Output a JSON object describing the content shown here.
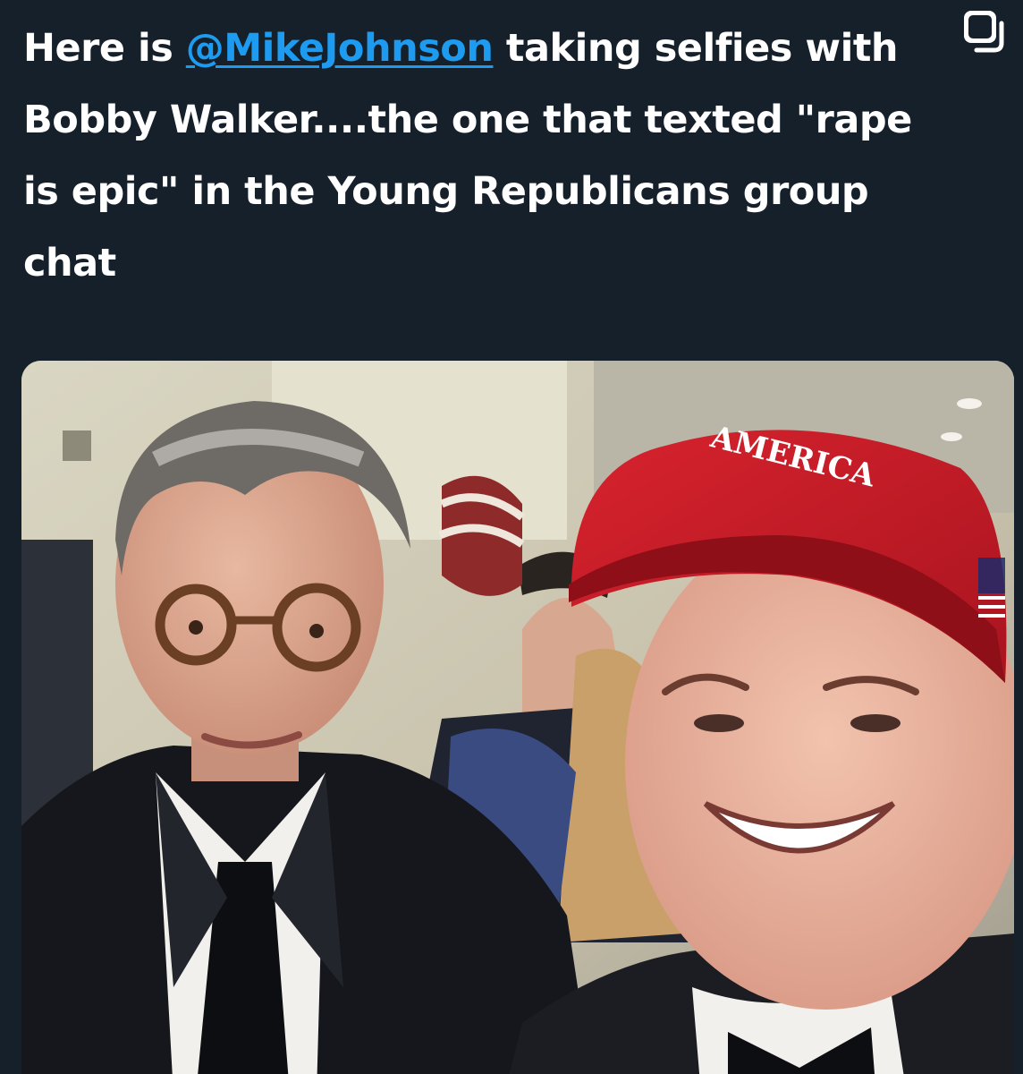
{
  "tweet": {
    "text_before": "Here is ",
    "mention": "@MikeJohnson",
    "text_after": " taking selfies with Bobby Walker....the one that texted \"rape is epic\" in the Young Republicans group chat"
  },
  "icons": {
    "top_right": "copy-icon"
  },
  "photo": {
    "hat_text": "AMERICA"
  },
  "colors": {
    "background": "#15202b",
    "text": "#ffffff",
    "mention": "#1d9bf0",
    "hat": "#c81c28"
  }
}
